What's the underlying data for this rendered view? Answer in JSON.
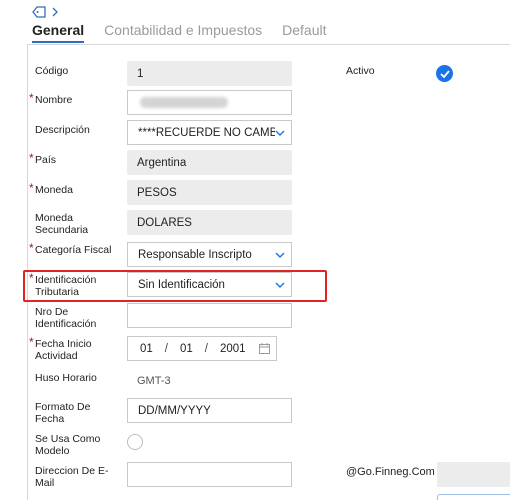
{
  "tabs": [
    {
      "label": "General",
      "active": true
    },
    {
      "label": "Contabilidad e Impuestos",
      "active": false
    },
    {
      "label": "Default",
      "active": false
    }
  ],
  "icons": {
    "tag": "tag-icon",
    "chevron": "chevron-right-icon",
    "calendar": "calendar-icon",
    "check": "checkmark-icon"
  },
  "colors": {
    "accent": "#1a73e8",
    "required": "#d0021b",
    "highlight": "#e02424"
  },
  "form": {
    "codigo": {
      "label": "Código",
      "value": "1"
    },
    "nombre": {
      "label": "Nombre",
      "required": true
    },
    "descripcion": {
      "label": "Descripción",
      "value": "****RECUERDE NO CAMB"
    },
    "pais": {
      "label": "País",
      "required": true,
      "value": "Argentina"
    },
    "moneda": {
      "label": "Moneda",
      "required": true,
      "value": "PESOS"
    },
    "moneda_secundaria": {
      "label": "Moneda Secundaria",
      "value": "DOLARES"
    },
    "categoria_fiscal": {
      "label": "Categoría Fiscal",
      "required": true,
      "value": "Responsable Inscripto"
    },
    "identificacion_tributaria": {
      "label": "Identificación Tributaria",
      "required": true,
      "value": "Sin Identificación"
    },
    "nro_identificacion": {
      "label": "Nro De Identificación",
      "value": ""
    },
    "fecha_inicio": {
      "label": "Fecha Inicio Actividad",
      "required": true,
      "day": "01",
      "month": "01",
      "year": "2001"
    },
    "huso_horario": {
      "label": "Huso Horario",
      "value": "GMT-3"
    },
    "formato_fecha": {
      "label": "Formato De Fecha",
      "value": "DD/MM/YYYY"
    },
    "usa_modelo": {
      "label": "Se Usa Como Modelo"
    },
    "direccion_email": {
      "label": "Direccion De E-Mail",
      "value": ""
    }
  },
  "right": {
    "activo_label": "Activo",
    "activo_checked": true,
    "email_domain": "@Go.Finneg.Com"
  }
}
